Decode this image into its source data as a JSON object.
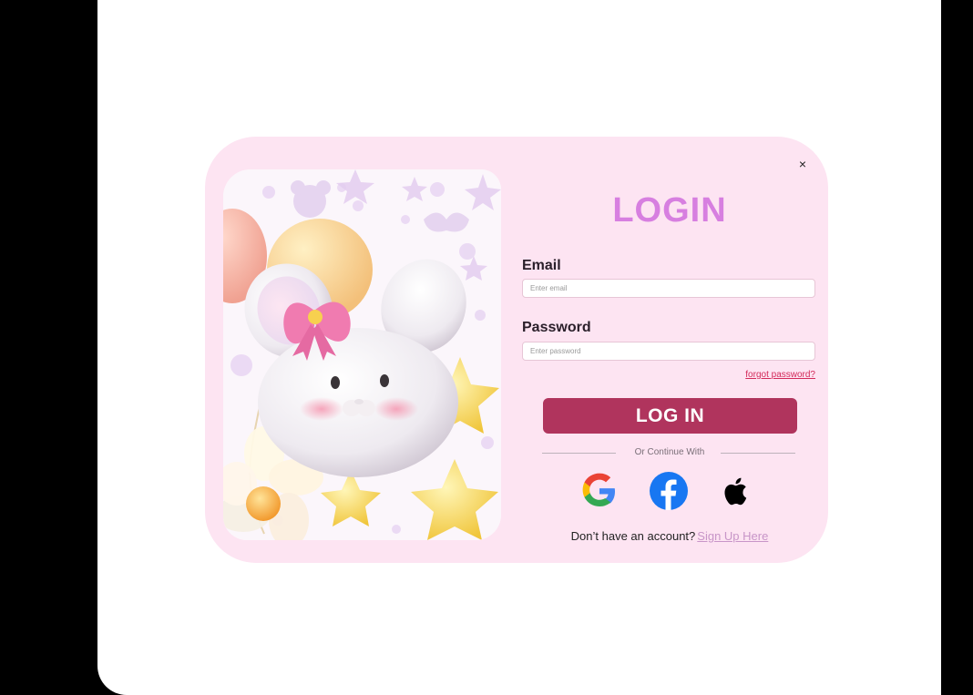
{
  "login": {
    "close_symbol": "×",
    "title": "LOGIN",
    "email_label": "Email",
    "email_placeholder": "Enter email",
    "password_label": "Password",
    "password_placeholder": "Enter password",
    "forgot_label": "forgot password?",
    "submit_label": "LOG IN",
    "divider_text": "Or Continue With",
    "social": [
      "google-icon",
      "facebook-icon",
      "apple-icon"
    ],
    "signup_prompt": "Don’t have an account?",
    "signup_link": "Sign Up Here"
  },
  "colors": {
    "card_background": "#fde4f2",
    "title": "#d77fe0",
    "primary_button": "#b0345d",
    "forgot_link": "#d32a5a",
    "signup_link": "#c895c8"
  }
}
